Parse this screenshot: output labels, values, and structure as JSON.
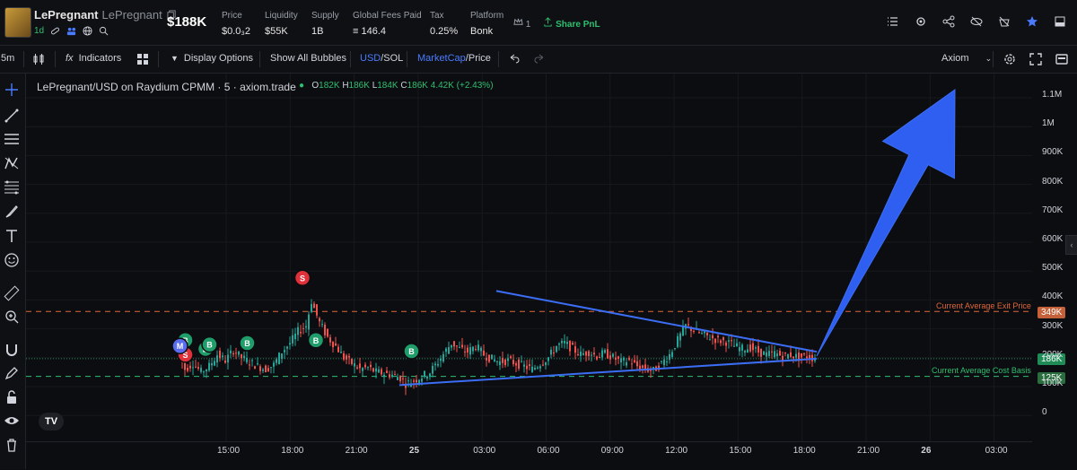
{
  "header": {
    "token_name": "LePregnant",
    "token_subname": "LePregnant",
    "age": "1d",
    "market_cap": "$188K",
    "stats": [
      {
        "label": "Price",
        "value": "$0.0₃2"
      },
      {
        "label": "Liquidity",
        "value": "$55K"
      },
      {
        "label": "Supply",
        "value": "1B"
      },
      {
        "label": "Global Fees Paid",
        "value": "≡ 146.4"
      },
      {
        "label": "Tax",
        "value": "0.25%"
      },
      {
        "label": "Platform",
        "value": "Bonk"
      }
    ],
    "holders_count": "1",
    "share_label": "Share PnL"
  },
  "toolbar": {
    "interval": "5m",
    "indicators": "Indicators",
    "display_options": "Display Options",
    "show_bubbles": "Show All Bubbles",
    "usd": "USD",
    "sol": "/SOL",
    "marketcap": "MarketCap",
    "price": "/Price",
    "brand": "Axiom"
  },
  "chart": {
    "title": "LePregnant/USD on Raydium CPMM · 5 · axiom.trade",
    "ohlc": {
      "o": "182K",
      "h": "186K",
      "l": "184K",
      "c": "186K",
      "change": "4.42K (+2.43%)"
    },
    "exit_label": "Current Average Exit Price",
    "basis_label": "Current Average Cost Basis",
    "tags": {
      "exit": "349K",
      "current": "186K",
      "basis": "125K"
    },
    "tv": "TV"
  },
  "chart_data": {
    "type": "candlestick",
    "y_ticks": [
      "1.1M",
      "1M",
      "900K",
      "800K",
      "700K",
      "600K",
      "500K",
      "400K",
      "300K",
      "200K",
      "100K",
      "0"
    ],
    "x_ticks": [
      "15:00",
      "18:00",
      "21:00",
      "25",
      "03:00",
      "06:00",
      "09:00",
      "12:00",
      "15:00",
      "18:00",
      "21:00",
      "26",
      "03:00"
    ],
    "reference_lines": [
      {
        "label": "Current Average Exit Price",
        "value": 349000,
        "color": "#e0663a"
      },
      {
        "label": "Current Average Cost Basis",
        "value": 125000,
        "color": "#2fbf71"
      }
    ],
    "current_value": 186000,
    "close_path": [
      [
        0,
        220
      ],
      [
        6,
        150
      ],
      [
        12,
        170
      ],
      [
        18,
        140
      ],
      [
        24,
        160
      ],
      [
        30,
        200
      ],
      [
        36,
        180
      ],
      [
        42,
        215
      ],
      [
        48,
        190
      ],
      [
        54,
        175
      ],
      [
        60,
        160
      ],
      [
        66,
        150
      ],
      [
        72,
        165
      ],
      [
        78,
        210
      ],
      [
        84,
        240
      ],
      [
        90,
        280
      ],
      [
        96,
        300
      ],
      [
        100,
        385
      ],
      [
        106,
        310
      ],
      [
        112,
        260
      ],
      [
        118,
        230
      ],
      [
        124,
        190
      ],
      [
        130,
        170
      ],
      [
        136,
        150
      ],
      [
        142,
        155
      ],
      [
        148,
        140
      ],
      [
        154,
        135
      ],
      [
        160,
        130
      ],
      [
        166,
        120
      ],
      [
        170,
        100
      ],
      [
        176,
        110
      ],
      [
        182,
        125
      ],
      [
        188,
        140
      ],
      [
        194,
        175
      ],
      [
        200,
        215
      ],
      [
        204,
        240
      ],
      [
        210,
        220
      ],
      [
        216,
        210
      ],
      [
        222,
        230
      ],
      [
        228,
        200
      ],
      [
        234,
        185
      ],
      [
        240,
        175
      ],
      [
        246,
        180
      ],
      [
        252,
        170
      ],
      [
        258,
        160
      ],
      [
        264,
        150
      ],
      [
        270,
        170
      ],
      [
        276,
        190
      ],
      [
        282,
        230
      ],
      [
        288,
        240
      ],
      [
        294,
        220
      ],
      [
        300,
        200
      ],
      [
        306,
        210
      ],
      [
        312,
        195
      ],
      [
        318,
        205
      ],
      [
        324,
        190
      ],
      [
        330,
        175
      ],
      [
        336,
        180
      ],
      [
        342,
        160
      ],
      [
        348,
        150
      ],
      [
        354,
        145
      ],
      [
        360,
        170
      ],
      [
        366,
        200
      ],
      [
        372,
        250
      ],
      [
        378,
        300
      ],
      [
        384,
        285
      ],
      [
        390,
        270
      ],
      [
        396,
        260
      ],
      [
        402,
        250
      ],
      [
        408,
        245
      ],
      [
        414,
        230
      ],
      [
        420,
        220
      ],
      [
        426,
        225
      ],
      [
        432,
        210
      ],
      [
        438,
        200
      ],
      [
        444,
        205
      ],
      [
        450,
        195
      ],
      [
        456,
        200
      ],
      [
        462,
        190
      ],
      [
        468,
        195
      ],
      [
        474,
        186
      ]
    ],
    "buy_markers": [
      [
        5,
        250
      ],
      [
        20,
        220
      ],
      [
        23,
        235
      ],
      [
        51,
        240
      ],
      [
        102,
        250
      ],
      [
        173,
        212
      ]
    ],
    "sell_markers": [
      [
        5,
        200
      ],
      [
        92,
        465
      ]
    ],
    "migration_markers": [
      [
        1,
        230
      ]
    ],
    "trendlines": [
      {
        "from": [
          164,
          95
        ],
        "to": [
          474,
          186
        ]
      },
      {
        "from": [
          236,
          420
        ],
        "to": [
          474,
          210
        ]
      }
    ],
    "arrow": {
      "from": [
        474,
        195
      ],
      "to": [
        625,
        1100
      ]
    }
  }
}
